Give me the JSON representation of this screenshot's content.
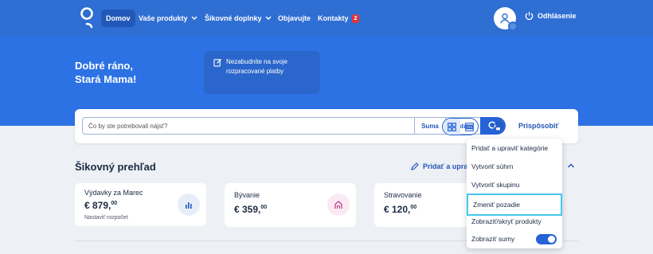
{
  "nav": {
    "home": "Domov",
    "products": "Vaše produkty",
    "addons": "Šikovné doplnky",
    "discover": "Objavujte",
    "contacts": "Kontakty",
    "contacts_badge": "2",
    "logout": "Odhlásenie"
  },
  "hero": {
    "greeting_line1": "Dobré ráno,",
    "greeting_line2": "Stará Mama!",
    "notice": "Nezabudnite na svoje rozpracované platby"
  },
  "search": {
    "placeholder": "Čo by ste potrebovali nájsť?",
    "amount_label": "Suma",
    "date_label": "Dátum",
    "customize_label": "Prispôsobiť"
  },
  "overview": {
    "title": "Šikovný prehľad",
    "add_link": "Pridať a upraviť"
  },
  "cards": [
    {
      "label": "Výdavky za Marec",
      "amount": "€ 879,",
      "cents": "00",
      "link": "Nastaviť rozpočet"
    },
    {
      "label": "Bývanie",
      "amount": "€ 359,",
      "cents": "00"
    },
    {
      "label": "Stravovanie",
      "amount": "€ 120,",
      "cents": "00"
    }
  ],
  "menu": {
    "items": [
      "Pridať a upraviť kategórie",
      "Vytvoriť súhrn",
      "Vytvoriť skupinu",
      "Zmeniť pozadie",
      "Zobraziť/skryť produkty",
      "Zobraziť sumy"
    ],
    "show_amounts_on": true,
    "highlighted_index": 3
  },
  "colors": {
    "brand_blue": "#2d72e4",
    "accent": "#2563d6",
    "highlight": "#46c7ef",
    "badge": "#e4323a"
  }
}
